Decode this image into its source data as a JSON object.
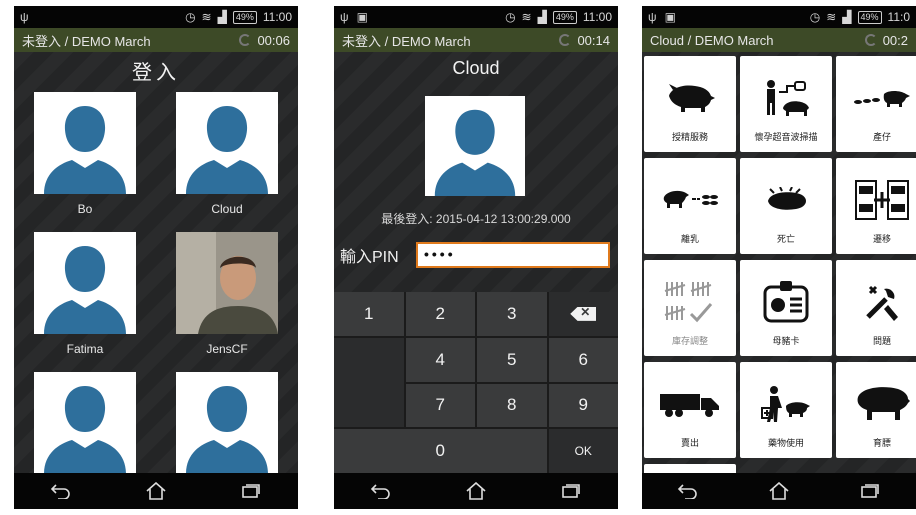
{
  "status": {
    "time": "11:00",
    "battery": "49%"
  },
  "status3": {
    "time": "11:0",
    "battery": "49%"
  },
  "screen1": {
    "appbar_title": "未登入 / DEMO March",
    "timer": "00:06",
    "heading": "登入",
    "users": [
      "Bo",
      "Cloud",
      "Fatima",
      "JensCF"
    ]
  },
  "screen2": {
    "appbar_title": "未登入 / DEMO March",
    "timer": "00:14",
    "heading": "Cloud",
    "last_login": "最後登入: 2015-04-12 13:00:29.000",
    "pin_label": "輸入PIN",
    "pin_value": "••••",
    "keys": [
      "1",
      "2",
      "3",
      "4",
      "5",
      "6",
      "7",
      "8",
      "9",
      "0"
    ],
    "ok_label": "OK"
  },
  "screen3": {
    "appbar_title": "Cloud / DEMO March",
    "timer": "00:2",
    "menu": [
      {
        "label": "授精服務",
        "icon": "pig-boar-icon"
      },
      {
        "label": "懷孕超音波掃描",
        "icon": "ultrasound-scan-icon"
      },
      {
        "label": "產仔",
        "icon": "farrowing-icon"
      },
      {
        "label": "離乳",
        "icon": "weaning-icon"
      },
      {
        "label": "死亡",
        "icon": "dead-pig-icon"
      },
      {
        "label": "遷移",
        "icon": "move-pigs-icon"
      },
      {
        "label": "庫存調整",
        "icon": "inventory-adjust-icon"
      },
      {
        "label": "母豬卡",
        "icon": "sow-card-icon"
      },
      {
        "label": "問題",
        "icon": "tools-icon"
      },
      {
        "label": "賣出",
        "icon": "truck-icon"
      },
      {
        "label": "藥物使用",
        "icon": "medicine-icon"
      },
      {
        "label": "育膘",
        "icon": "fattening-pig-icon"
      }
    ]
  }
}
